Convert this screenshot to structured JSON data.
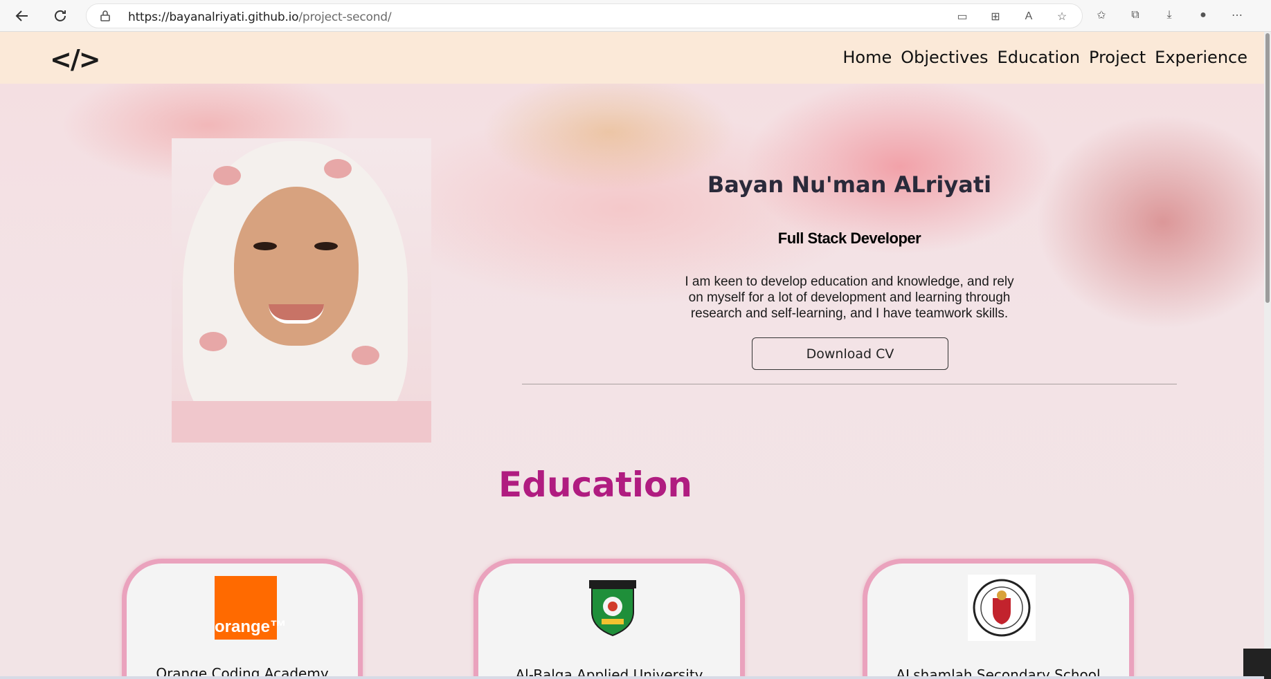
{
  "browser": {
    "url_host": "https://bayanalriyati.github.io",
    "url_path": "/project-second/"
  },
  "header": {
    "logo": "</>",
    "nav": [
      {
        "label": "Home"
      },
      {
        "label": "Objectives"
      },
      {
        "label": "Education"
      },
      {
        "label": "Project"
      },
      {
        "label": "Experience"
      }
    ]
  },
  "hero": {
    "name": "Bayan Nu'man ALriyati",
    "role": "Full Stack Developer",
    "bio": "I am keen to develop education and knowledge, and rely on myself for a lot of development and learning through research and self-learning, and I have teamwork skills.",
    "cv_button": "Download CV"
  },
  "education": {
    "title": "Education",
    "items": [
      {
        "name": "Orange Coding Academy",
        "logo_text": "orange™"
      },
      {
        "name": "Al-Balqa Applied University"
      },
      {
        "name": "ALshamlah Secondary School"
      }
    ]
  },
  "colors": {
    "header_bg": "#fbe9d8",
    "accent": "#b01c80",
    "card_border": "#eaa2bd",
    "orange_brand": "#ff6a00"
  }
}
